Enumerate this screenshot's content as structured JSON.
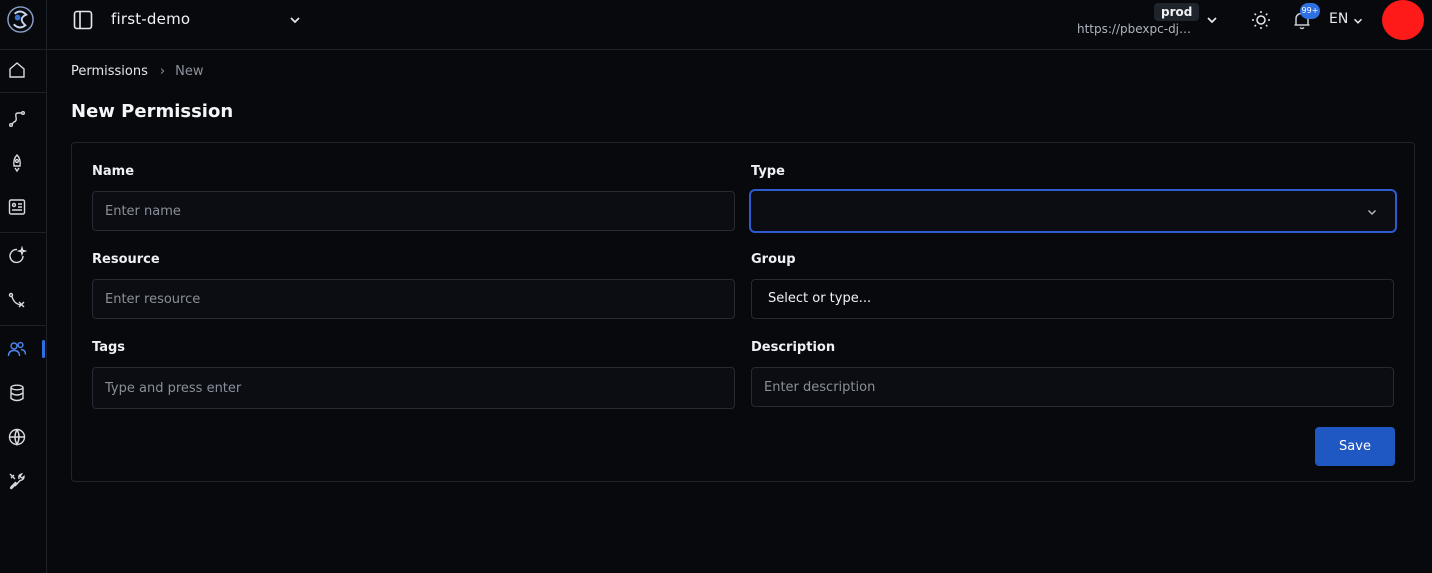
{
  "header": {
    "project_name": "first-demo",
    "env_badge": "prod",
    "env_url": "https://pbexpc-djp...",
    "notification_count": "99+",
    "language": "EN"
  },
  "breadcrumb": {
    "root": "Permissions",
    "separator": "›",
    "current": "New"
  },
  "page": {
    "title": "New Permission"
  },
  "form": {
    "name_label": "Name",
    "name_placeholder": "Enter name",
    "name_value": "",
    "type_label": "Type",
    "type_value": "",
    "resource_label": "Resource",
    "resource_placeholder": "Enter resource",
    "resource_value": "",
    "group_label": "Group",
    "group_value": "Select or type...",
    "tags_label": "Tags",
    "tags_placeholder": "Type and press enter",
    "description_label": "Description",
    "description_placeholder": "Enter description",
    "description_value": "",
    "save_label": "Save"
  },
  "sidebar": {
    "items": [
      {
        "icon": "home-icon"
      },
      {
        "icon": "route-icon"
      },
      {
        "icon": "rocket-icon"
      },
      {
        "icon": "dashboard-icon"
      },
      {
        "icon": "spark-icon"
      },
      {
        "icon": "flow-icon"
      },
      {
        "icon": "users-icon",
        "active": true
      },
      {
        "icon": "database-icon"
      },
      {
        "icon": "globe-icon"
      },
      {
        "icon": "tools-icon"
      }
    ]
  },
  "colors": {
    "accent": "#2f6fe4",
    "primary_button": "#1f57c3",
    "avatar": "#ff1a1a",
    "background": "#07090d"
  }
}
